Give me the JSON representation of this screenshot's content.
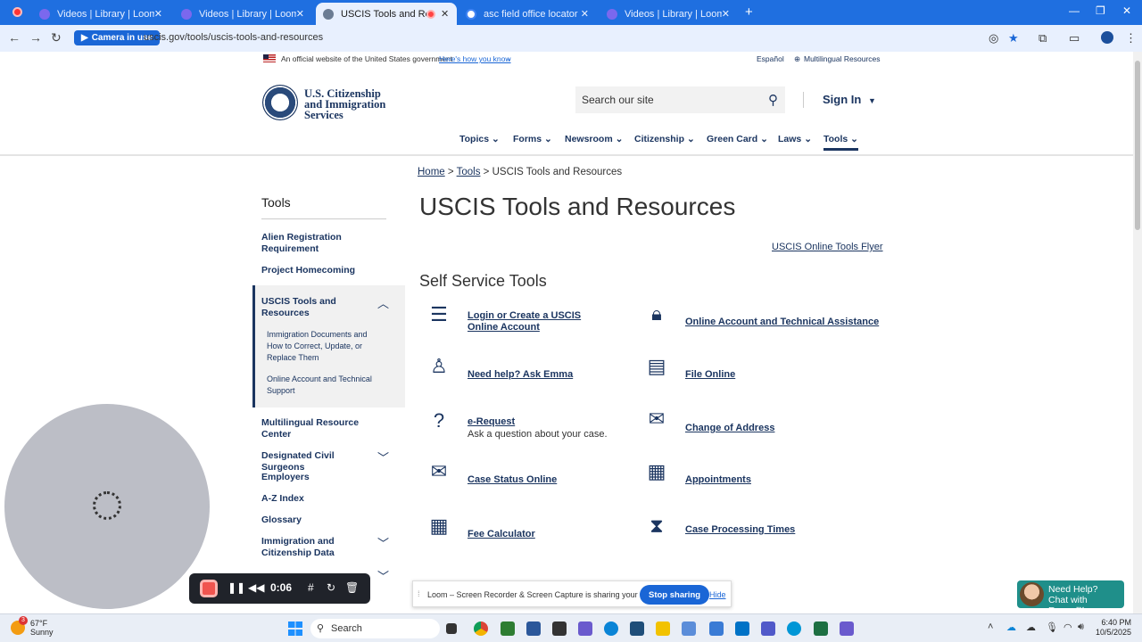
{
  "browser": {
    "tabs": [
      {
        "title": "Videos | Library | Loom",
        "active": false
      },
      {
        "title": "Videos | Library | Loom",
        "active": false
      },
      {
        "title": "USCIS Tools and Resources",
        "active": true
      },
      {
        "title": "asc field office locator - Google",
        "active": false
      },
      {
        "title": "Videos | Library | Loom",
        "active": false
      }
    ],
    "camera_badge": "Camera in use",
    "url": "uscis.gov/tools/uscis-tools-and-resources"
  },
  "gov_banner": {
    "official_text": "An official website of the United States government",
    "how_you_know": "Here's how you know",
    "espanol": "Español",
    "multilingual": "Multilingual Resources"
  },
  "header": {
    "agency_line1": "U.S. Citizenship",
    "agency_line2": "and Immigration",
    "agency_line3": "Services",
    "search_placeholder": "Search our site",
    "sign_in": "Sign In",
    "nav": [
      "Topics",
      "Forms",
      "Newsroom",
      "Citizenship",
      "Green Card",
      "Laws",
      "Tools"
    ],
    "active_nav": "Tools"
  },
  "sidebar": {
    "title": "Tools",
    "items": [
      "Alien Registration Requirement",
      "Project Homecoming",
      "USCIS Tools and Resources",
      "Multilingual Resource Center",
      "Designated Civil Surgeons",
      "Employers",
      "A-Z Index",
      "Glossary",
      "Immigration and Citizenship Data"
    ],
    "sub_items": [
      "Immigration Documents and How to Correct, Update, or Replace Them",
      "Online Account and Technical Support"
    ]
  },
  "main": {
    "breadcrumb": {
      "home": "Home",
      "tools": "Tools",
      "current": "USCIS Tools and Resources",
      "sep": ">"
    },
    "title": "USCIS Tools and Resources",
    "flyer_link": "USCIS Online Tools Flyer",
    "section_title": "Self Service Tools",
    "tools": [
      {
        "label": "Login or Create a USCIS Online Account",
        "icon": "account-list-icon"
      },
      {
        "label": "Online Account and Technical Assistance",
        "icon": "lock-icon"
      },
      {
        "label": "Need help?  Ask Emma",
        "icon": "person-icon"
      },
      {
        "label": "File Online",
        "icon": "document-icon"
      },
      {
        "label": "e-Request",
        "desc": "Ask a question about your case.",
        "icon": "question-icon"
      },
      {
        "label": "Change of Address",
        "icon": "envelope-icon"
      },
      {
        "label": "Case Status Online",
        "icon": "check-envelope-icon"
      },
      {
        "label": "Appointments",
        "icon": "calendar-icon"
      },
      {
        "label": "Fee Calculator",
        "icon": "calculator-icon"
      },
      {
        "label": "Case Processing Times",
        "icon": "hourglass-icon"
      }
    ]
  },
  "loom": {
    "timer": "0:06",
    "share_message": "Loom – Screen Recorder & Screen Capture is sharing your screen.",
    "stop_sharing": "Stop sharing",
    "hide": "Hide"
  },
  "emma_chat": {
    "line1": "Need Help?",
    "line2": "Chat with Emma™"
  },
  "taskbar": {
    "weather_badge": "3",
    "temp": "67°F",
    "weather": "Sunny",
    "search": "Search",
    "time": "6:40 PM",
    "date": "10/5/2025"
  },
  "colors": {
    "brand_navy": "#1b3560",
    "tab_bar": "#1f6fe0",
    "loom_red": "#f0544f"
  }
}
